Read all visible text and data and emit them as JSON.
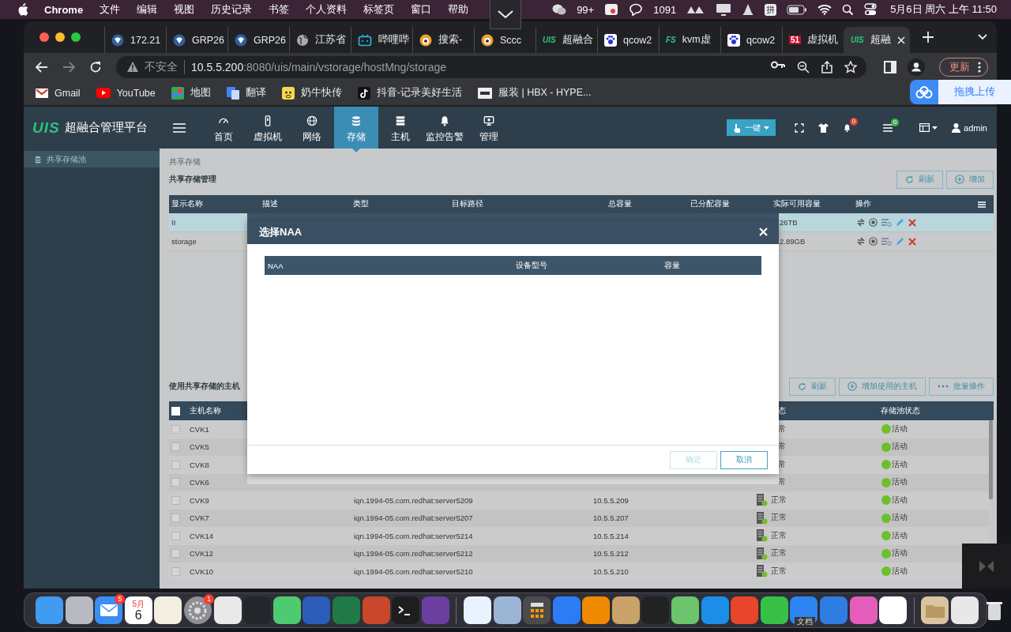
{
  "menubar": {
    "app": "Chrome",
    "menus": [
      "文件",
      "编辑",
      "视图",
      "历史记录",
      "书签",
      "个人资料",
      "标签页",
      "窗口",
      "帮助"
    ],
    "chat_badge": "99+",
    "message_count": "1091",
    "input_method": "拼",
    "clock": "5月6日 周六 上午 11:50"
  },
  "browser": {
    "tabs": [
      {
        "title": "172.21",
        "kind": "shield",
        "selected": false
      },
      {
        "title": "GRP26",
        "kind": "shield",
        "selected": false
      },
      {
        "title": "GRP26",
        "kind": "shield",
        "selected": false
      },
      {
        "title": "江苏省",
        "kind": "globe",
        "selected": false
      },
      {
        "title": "哔哩哔",
        "kind": "tv",
        "selected": false
      },
      {
        "title": "搜索-",
        "kind": "orange",
        "selected": false
      },
      {
        "title": "Sccc",
        "kind": "orange",
        "selected": false
      },
      {
        "title": "超融合",
        "kind": "logo",
        "logo_text": "UIS",
        "selected": false
      },
      {
        "title": "qcow2",
        "kind": "paw",
        "selected": false
      },
      {
        "title": "kvm虚",
        "kind": "logo",
        "logo_text": "FS",
        "selected": false
      },
      {
        "title": "qcow2",
        "kind": "paw",
        "selected": false
      },
      {
        "title": "虚拟机",
        "kind": "redlogo",
        "logo_text": "51",
        "selected": false
      },
      {
        "title": "超融",
        "kind": "logo",
        "logo_text": "UIS",
        "selected": true
      }
    ],
    "address": {
      "security": "不安全",
      "host": "10.5.5.200",
      "path": ":8080/uis/main/vstorage/hostMng/storage"
    },
    "update_button": "更新",
    "bookmarks": [
      {
        "label": "Gmail",
        "kind": "mail"
      },
      {
        "label": "YouTube",
        "kind": "play"
      },
      {
        "label": "地图",
        "kind": "map"
      },
      {
        "label": "翻译",
        "kind": "translate"
      },
      {
        "label": "奶牛快传",
        "kind": "cow"
      },
      {
        "label": "抖音-记录美好生活",
        "kind": "note"
      },
      {
        "label": "服装 | HBX - HYPE...",
        "kind": "hbx"
      }
    ]
  },
  "upload_widget": {
    "label": "拖拽上传"
  },
  "app": {
    "logo": "UIS",
    "title": "超融合管理平台",
    "nav": [
      {
        "label": "首页",
        "kind": "gauge",
        "selected": false
      },
      {
        "label": "虚拟机",
        "kind": "phone",
        "selected": false
      },
      {
        "label": "网络",
        "kind": "globe",
        "selected": false
      },
      {
        "label": "存储",
        "kind": "db",
        "selected": true
      },
      {
        "label": "主机",
        "kind": "server",
        "selected": false
      },
      {
        "label": "监控告警",
        "kind": "bell",
        "selected": false
      },
      {
        "label": "管理",
        "kind": "monitor",
        "selected": false
      }
    ],
    "one_click_button": "一键",
    "alert_count": "0",
    "task_count": "0",
    "user": "admin",
    "sidebar": [
      {
        "label": "共享存储池",
        "selected": true
      }
    ],
    "breadcrumb": "共享存储",
    "heading": "共享存储管理",
    "toolbar": [
      {
        "label": "刷新",
        "kind": "refresh"
      },
      {
        "label": "增加",
        "kind": "add"
      }
    ],
    "storage_table": {
      "columns": [
        "显示名称",
        "描述",
        "类型",
        "目标路径",
        "总容量",
        "已分配容量",
        "实际可用容量",
        "操作"
      ],
      "rows": [
        {
          "name": "II",
          "available": "26TB",
          "selected": true
        },
        {
          "name": "storage",
          "available": "2.89GB",
          "selected": false
        }
      ]
    },
    "hosts_heading": "使用共享存储的主机",
    "hosts_toolbar": [
      {
        "label": "刷新",
        "kind": "refresh"
      },
      {
        "label": "增加使用的主机",
        "kind": "add"
      },
      {
        "label": "批量操作",
        "kind": "more"
      }
    ],
    "hosts_table": {
      "select_all_checked": false,
      "columns": {
        "name": "主机名称",
        "status": "态",
        "pool": "存储池状态"
      },
      "rows": [
        {
          "name": "CVK1",
          "status": "常",
          "pool": "活动",
          "checked": false
        },
        {
          "name": "CVK5",
          "status": "常",
          "pool": "活动",
          "checked": false
        },
        {
          "name": "CVK8",
          "status": "常",
          "pool": "活动",
          "checked": false
        },
        {
          "name": "CVK6",
          "status": "常",
          "pool": "活动",
          "checked": false
        },
        {
          "name": "CVK9",
          "iqn": "iqn.1994-05.com.redhat:server5209",
          "ip": "10.5.5.209",
          "status": "正常",
          "pool": "活动",
          "checked": false
        },
        {
          "name": "CVK7",
          "iqn": "iqn.1994-05.com.redhat:server5207",
          "ip": "10.5.5.207",
          "status": "正常",
          "pool": "活动",
          "checked": false
        },
        {
          "name": "CVK14",
          "iqn": "iqn.1994-05.com.redhat:server5214",
          "ip": "10.5.5.214",
          "status": "正常",
          "pool": "活动",
          "checked": false
        },
        {
          "name": "CVK12",
          "iqn": "iqn.1994-05.com.redhat:server5212",
          "ip": "10.5.5.212",
          "status": "正常",
          "pool": "活动",
          "checked": false
        },
        {
          "name": "CVK10",
          "iqn": "iqn.1994-05.com.redhat:server5210",
          "ip": "10.5.5.210",
          "status": "正常",
          "pool": "活动",
          "checked": false
        }
      ]
    }
  },
  "dialog": {
    "title": "选择NAA",
    "columns": [
      "NAA",
      "设备型号",
      "容量"
    ],
    "buttons": [
      {
        "label": "确定",
        "disabled": true
      },
      {
        "label": "取消",
        "disabled": false
      }
    ]
  },
  "dock": [
    {
      "kind": "finder"
    },
    {
      "kind": "launchpad"
    },
    {
      "kind": "mail",
      "badge": "5"
    },
    {
      "kind": "calendar",
      "month": "5月",
      "day": "6"
    },
    {
      "kind": "notes"
    },
    {
      "kind": "settings",
      "badge": "1"
    },
    {
      "kind": "chrome"
    },
    {
      "kind": "green-s"
    },
    {
      "kind": "mindmap"
    },
    {
      "kind": "word"
    },
    {
      "kind": "excel"
    },
    {
      "kind": "powerpoint"
    },
    {
      "kind": "terminal"
    },
    {
      "kind": "tasks"
    },
    {
      "kind": "separator"
    },
    {
      "kind": "chat"
    },
    {
      "kind": "preview"
    },
    {
      "kind": "calculator"
    },
    {
      "kind": "meeting"
    },
    {
      "kind": "vlc"
    },
    {
      "kind": "archive"
    },
    {
      "kind": "activity"
    },
    {
      "kind": "maps"
    },
    {
      "kind": "blue-app"
    },
    {
      "kind": "red-app"
    },
    {
      "kind": "wechat"
    },
    {
      "kind": "docs",
      "label": "文档"
    },
    {
      "kind": "remote"
    },
    {
      "kind": "pink-app"
    },
    {
      "kind": "cloud"
    },
    {
      "kind": "separator"
    },
    {
      "kind": "folder"
    },
    {
      "kind": "documents"
    },
    {
      "kind": "trash"
    }
  ]
}
